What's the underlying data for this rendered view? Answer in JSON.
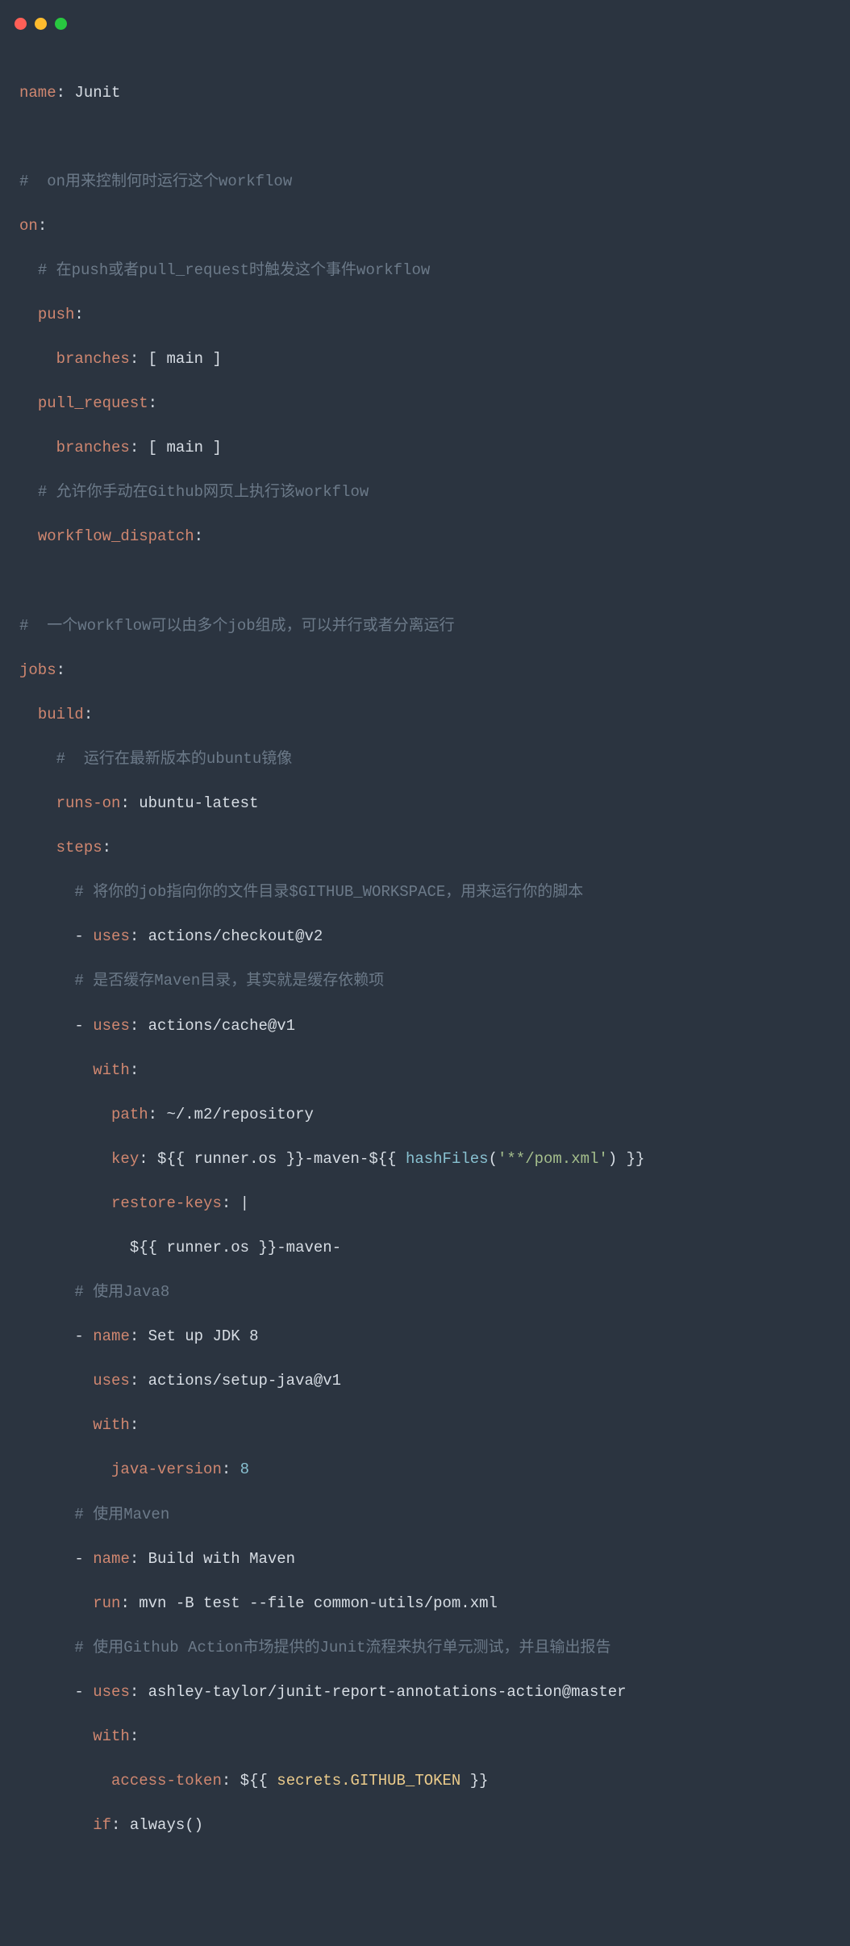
{
  "tokens": {
    "name_key": "name",
    "name_val": " Junit",
    "c1": "#  on用来控制何时运行这个workflow",
    "on_key": "on",
    "c2": "# 在push或者pull_request时触发这个事件workflow",
    "push_key": "push",
    "branches_key": "branches",
    "branches_val": " [ main ]",
    "pull_request_key": "pull_request",
    "c3": "# 允许你手动在Github网页上执行该workflow",
    "workflow_dispatch_key": "workflow_dispatch",
    "c4": "#  一个workflow可以由多个job组成，可以并行或者分离运行",
    "jobs_key": "jobs",
    "build_key": "build",
    "c5": "#  运行在最新版本的ubuntu镜像",
    "runs_on_key": "runs-on",
    "runs_on_val": " ubuntu-latest",
    "steps_key": "steps",
    "c6": "# 将你的job指向你的文件目录$GITHUB_WORKSPACE，用来运行你的脚本",
    "dash": "- ",
    "uses_key": "uses",
    "uses_checkout": " actions/checkout@v2",
    "c7": "# 是否缓存Maven目录，其实就是缓存依赖项",
    "uses_cache": " actions/cache@v1",
    "with_key": "with",
    "path_key": "path",
    "path_val": " ~/.m2/repository",
    "key_key": "key",
    "key_prefix": " $",
    "dollar_open": "{{",
    "dollar_close": "}}",
    "runner_os": " runner.os ",
    "key_mid": "-maven-$",
    "hashFiles_name": " hashFiles",
    "hashFiles_open": "(",
    "hashFiles_arg": "'**/pom.xml'",
    "hashFiles_close": ") ",
    "restore_keys_key": "restore-keys",
    "restore_keys_pipe": " |",
    "restore_line_prefix": "            $",
    "restore_suffix": "-maven-",
    "c8": "# 使用Java8",
    "name_step_key": "name",
    "name_jdk": " Set up JDK 8",
    "uses_java": " actions/setup-java@v1",
    "java_version_key": "java-version",
    "java_version_val": " 8",
    "c9": "# 使用Maven",
    "name_maven": " Build with Maven",
    "run_key": "run",
    "run_val": " mvn -B test --file common-utils/pom.xml",
    "c10": "# 使用Github Action市场提供的Junit流程来执行单元测试，并且输出报告",
    "uses_junit": " ashley-taylor/junit-report-annotations-action@master",
    "access_token_key": "access-token",
    "access_prefix": " $",
    "secrets_token": " secrets.GITHUB_TOKEN ",
    "if_key": "if",
    "if_val": " always()",
    "colon": ":"
  }
}
